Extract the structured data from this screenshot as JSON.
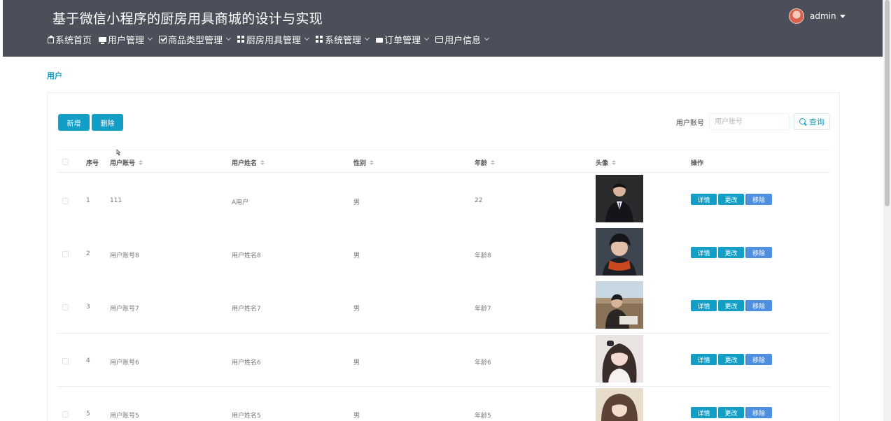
{
  "header": {
    "title": "基于微信小程序的厨房用具商城的设计与实现",
    "user": "admin",
    "nav": [
      {
        "label": "系统首页",
        "icon": "home-icon",
        "dropdown": false
      },
      {
        "label": "用户管理",
        "icon": "monitor-icon",
        "dropdown": true
      },
      {
        "label": "商品类型管理",
        "icon": "checkbox-icon",
        "dropdown": true
      },
      {
        "label": "厨房用具管理",
        "icon": "grid-icon",
        "dropdown": true
      },
      {
        "label": "系统管理",
        "icon": "grid-icon",
        "dropdown": true
      },
      {
        "label": "订单管理",
        "icon": "truck-icon",
        "dropdown": true
      },
      {
        "label": "用户信息",
        "icon": "card-icon",
        "dropdown": true
      }
    ]
  },
  "breadcrumb": "用户",
  "toolbar": {
    "add_label": "新增",
    "delete_label": "删除",
    "search_label": "用户账号",
    "search_placeholder": "用户账号",
    "query_label": "查询"
  },
  "table": {
    "columns": {
      "index": "序号",
      "account": "用户账号",
      "name": "用户姓名",
      "gender": "性别",
      "age": "年龄",
      "avatar": "头像",
      "actions": "操作"
    },
    "action_labels": {
      "detail": "详情",
      "edit": "更改",
      "remove": "移除"
    },
    "rows": [
      {
        "index": "1",
        "account": "111",
        "name": "A用户",
        "gender": "男",
        "age": "22",
        "photo": "man-in-suit"
      },
      {
        "index": "2",
        "account": "用户账号8",
        "name": "用户姓名8",
        "gender": "男",
        "age": "年龄8",
        "photo": "man-with-scarf"
      },
      {
        "index": "3",
        "account": "用户账号7",
        "name": "用户姓名7",
        "gender": "男",
        "age": "年龄7",
        "photo": "man-city-view"
      },
      {
        "index": "4",
        "account": "用户账号6",
        "name": "用户姓名6",
        "gender": "男",
        "age": "年龄6",
        "photo": "woman-long-hair"
      },
      {
        "index": "5",
        "account": "用户账号5",
        "name": "用户姓名5",
        "gender": "男",
        "age": "年龄5",
        "photo": "woman-light"
      }
    ]
  },
  "colors": {
    "header_bg": "#4a4f59",
    "primary": "#139ec6",
    "remove": "#4e8fdf"
  }
}
